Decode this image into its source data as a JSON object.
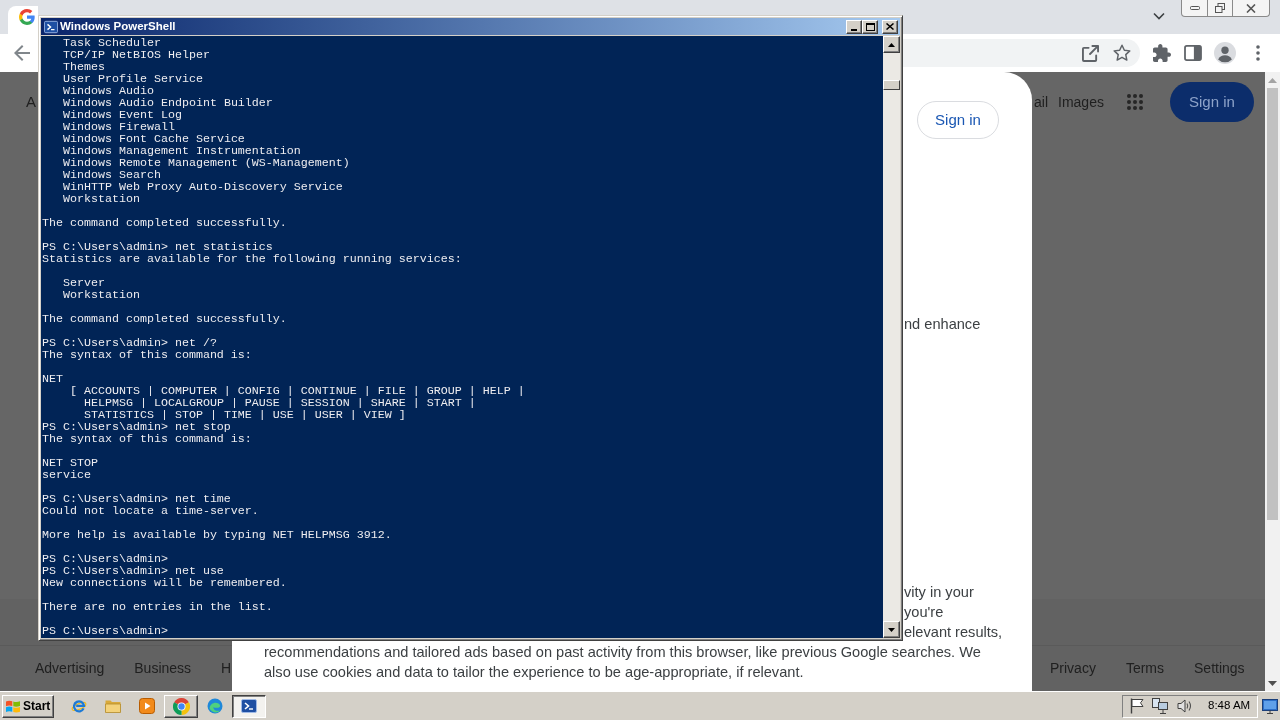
{
  "browser": {
    "page": {
      "header": {
        "left_link": "A",
        "links": [
          "ail",
          "Images"
        ],
        "sign_in": "Sign in"
      },
      "dialog": {
        "sign_in": "Sign in",
        "upper_text": "nd enhance",
        "line_fragments": [
          "vity in your",
          "you're",
          "elevant results,"
        ],
        "lines": [
          "recommendations and tailored ads based on past activity from this browser, like previous Google searches. We",
          "also use cookies and data to tailor the experience to be age-appropriate, if relevant."
        ]
      },
      "footer": {
        "left_links": [
          "Advertising",
          "Business",
          "H"
        ],
        "right_links": [
          "Privacy",
          "Terms",
          "Settings"
        ]
      }
    }
  },
  "powershell": {
    "title": "Windows PowerShell",
    "blocks": [
      {
        "lines": [
          "   Task Scheduler",
          "   TCP/IP NetBIOS Helper",
          "   Themes",
          "   User Profile Service",
          "   Windows Audio",
          "   Windows Audio Endpoint Builder",
          "   Windows Event Log",
          "   Windows Firewall",
          "   Windows Font Cache Service",
          "   Windows Management Instrumentation",
          "   Windows Remote Management (WS-Management)",
          "   Windows Search",
          "   WinHTTP Web Proxy Auto-Discovery Service",
          "   Workstation"
        ]
      },
      {
        "lines": [
          "The command completed successfully."
        ]
      },
      {
        "lines": [
          "PS C:\\Users\\admin> net statistics",
          "Statistics are available for the following running services:"
        ]
      },
      {
        "lines": [
          "   Server",
          "   Workstation"
        ]
      },
      {
        "lines": [
          "The command completed successfully."
        ]
      },
      {
        "lines": [
          "PS C:\\Users\\admin> net /?",
          "The syntax of this command is:"
        ]
      },
      {
        "lines": [
          "NET",
          "    [ ACCOUNTS | COMPUTER | CONFIG | CONTINUE | FILE | GROUP | HELP |",
          "      HELPMSG | LOCALGROUP | PAUSE | SESSION | SHARE | START |",
          "      STATISTICS | STOP | TIME | USE | USER | VIEW ]",
          "PS C:\\Users\\admin> net stop",
          "The syntax of this command is:"
        ]
      },
      {
        "lines": [
          "NET STOP",
          "service"
        ]
      },
      {
        "lines": [
          "PS C:\\Users\\admin> net time",
          "Could not locate a time-server."
        ]
      },
      {
        "lines": [
          "More help is available by typing NET HELPMSG 3912."
        ]
      },
      {
        "lines": [
          "PS C:\\Users\\admin>",
          "PS C:\\Users\\admin> net use",
          "New connections will be remembered."
        ]
      },
      {
        "lines": [
          "There are no entries in the list."
        ]
      },
      {
        "lines": [
          "PS C:\\Users\\admin>"
        ]
      }
    ]
  },
  "taskbar": {
    "start": "Start",
    "apps": [
      {
        "kind": "ie",
        "open": false,
        "selected": false
      },
      {
        "kind": "explorer",
        "open": false,
        "selected": false
      },
      {
        "kind": "media",
        "open": false,
        "selected": false
      },
      {
        "kind": "chrome",
        "open": true,
        "selected": false
      },
      {
        "kind": "edge",
        "open": false,
        "selected": false
      },
      {
        "kind": "powershell",
        "open": true,
        "selected": true
      }
    ],
    "clock": "8:48 AM"
  }
}
